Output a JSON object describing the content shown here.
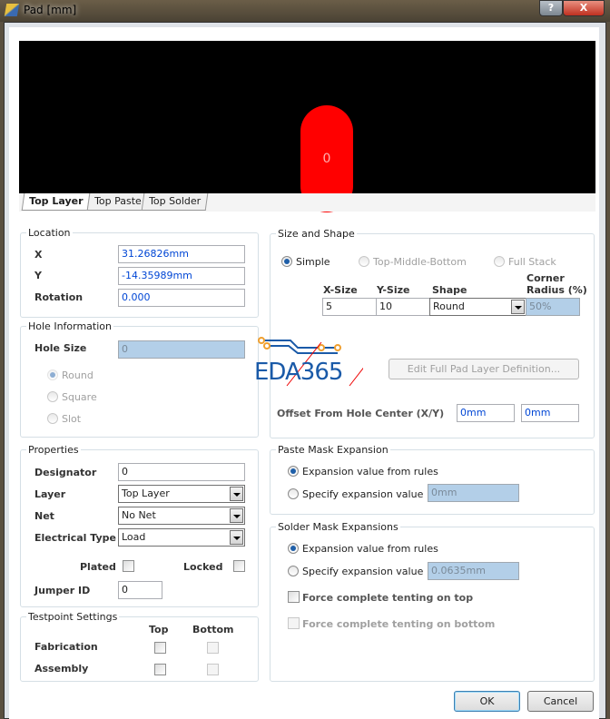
{
  "window": {
    "title": "Pad [mm]",
    "help": "?",
    "close": "X"
  },
  "preview": {
    "pad_label": "0",
    "tabs": [
      "Top Layer",
      "Top Paste",
      "Top Solder"
    ]
  },
  "location": {
    "legend": "Location",
    "x_label": "X",
    "x": "31.26826mm",
    "y_label": "Y",
    "y": "-14.35989mm",
    "rotation_label": "Rotation",
    "rotation": "0.000"
  },
  "hole": {
    "legend": "Hole Information",
    "size_label": "Hole Size",
    "size": "0",
    "round": "Round",
    "square": "Square",
    "slot": "Slot"
  },
  "properties": {
    "legend": "Properties",
    "designator_label": "Designator",
    "designator": "0",
    "layer_label": "Layer",
    "layer": "Top Layer",
    "net_label": "Net",
    "net": "No Net",
    "etype_label": "Electrical Type",
    "etype": "Load",
    "plated": "Plated",
    "locked": "Locked",
    "jumper_label": "Jumper ID",
    "jumper": "0"
  },
  "testpoint": {
    "legend": "Testpoint Settings",
    "top": "Top",
    "bottom": "Bottom",
    "fabrication": "Fabrication",
    "assembly": "Assembly"
  },
  "size_shape": {
    "legend": "Size and Shape",
    "simple": "Simple",
    "tmb": "Top-Middle-Bottom",
    "full": "Full Stack",
    "xsize_h": "X-Size",
    "ysize_h": "Y-Size",
    "shape_h": "Shape",
    "corner_h1": "Corner",
    "corner_h2": "Radius (%)",
    "xsize": "5",
    "ysize": "10",
    "shape": "Round",
    "corner": "50%",
    "edit_btn": "Edit Full Pad Layer Definition...",
    "offset_label": "Offset From Hole Center (X/Y)",
    "offset_x": "0mm",
    "offset_y": "0mm"
  },
  "watermark": "EDA365",
  "paste": {
    "legend": "Paste Mask Expansion",
    "from_rules": "Expansion value from rules",
    "specify": "Specify expansion value",
    "value": "0mm"
  },
  "solder": {
    "legend": "Solder Mask Expansions",
    "from_rules": "Expansion value from rules",
    "specify": "Specify expansion value",
    "value": "0.0635mm",
    "tent_top": "Force complete tenting on top",
    "tent_bottom": "Force complete tenting on bottom"
  },
  "buttons": {
    "ok": "OK",
    "cancel": "Cancel"
  },
  "colors": {
    "pad": "#ff0000",
    "accent": "#1f5fa8"
  }
}
